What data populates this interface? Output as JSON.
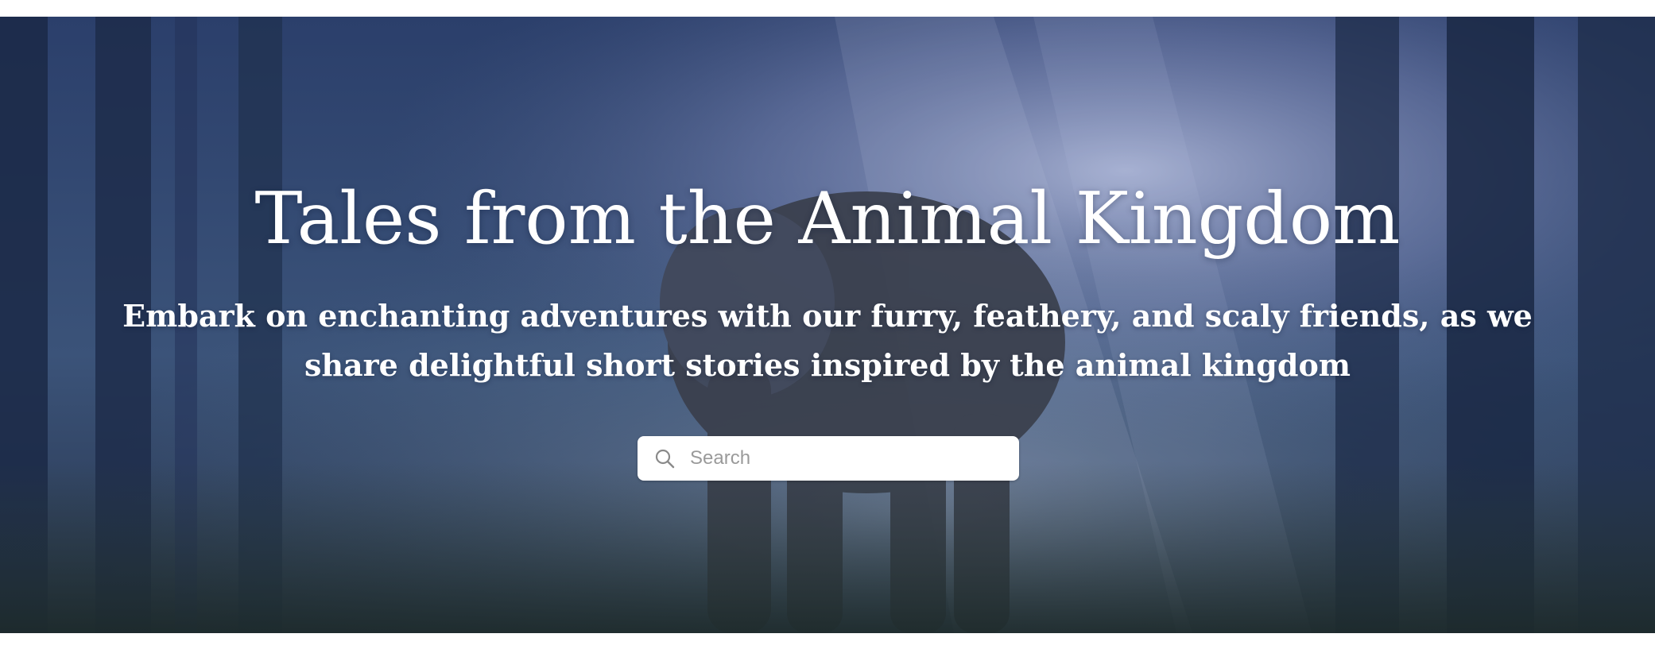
{
  "hero": {
    "title": "Tales from the Animal Kingdom",
    "subtitle": "Embark on enchanting adventures with our furry, feathery, and scaly friends, as we share delightful short stories inspired by the animal kingdom"
  },
  "search": {
    "placeholder": "Search",
    "value": "",
    "icon": "search-icon"
  },
  "colors": {
    "hero_overlay": "#24385e",
    "text": "#ffffff",
    "search_background": "#ffffff",
    "placeholder": "#9a9a9a"
  }
}
